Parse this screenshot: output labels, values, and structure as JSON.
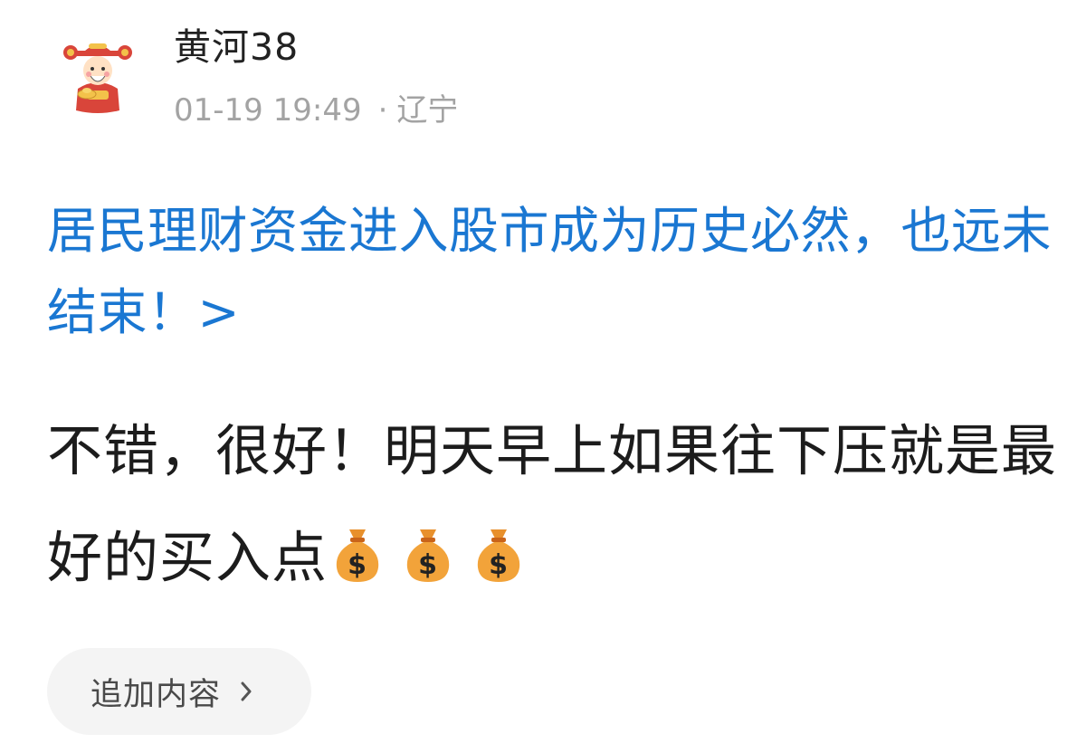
{
  "post": {
    "author": {
      "name": "黄河38",
      "avatar_icon": "caishen-avatar-icon"
    },
    "timestamp": "01-19 19:49",
    "separator": "·",
    "location": "辽宁",
    "linked_title": "居民理财资金进入股市成为历史必然，也远未结束！>",
    "body_text": "不错，很好！明天早上如果往下压就是最好的买入点",
    "emoji": [
      "money-bag-icon",
      "money-bag-icon",
      "money-bag-icon"
    ]
  },
  "actions": {
    "append_label": "追加内容"
  },
  "colors": {
    "link": "#1a77d2",
    "text": "#1c1c1c",
    "meta": "#a3a3a3",
    "button_bg": "#f4f4f4"
  }
}
